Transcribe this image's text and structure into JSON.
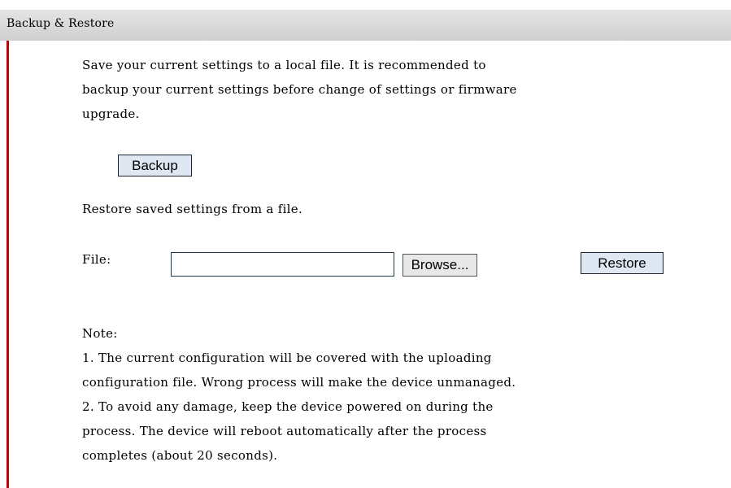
{
  "header": {
    "title": "Backup & Restore"
  },
  "backup": {
    "description_lines": [
      "Save your current settings to a local file. It is recommended to",
      "backup your current settings before change of settings or firmware",
      "upgrade."
    ],
    "button_label": "Backup"
  },
  "restore": {
    "description": "Restore saved settings from a file.",
    "file_label": "File:",
    "file_value": "",
    "browse_label": "Browse...",
    "button_label": "Restore"
  },
  "note": {
    "heading": "Note:",
    "lines": [
      "1. The current configuration will be covered with the uploading",
      "configuration file. Wrong process will make the device unmanaged.",
      "2. To avoid any damage, keep the device powered on during the",
      "process. The device will reboot automatically after the process",
      "completes (about 20 seconds)."
    ]
  },
  "colors": {
    "accent_rule": "#c00000",
    "header_bg": "#d8d8d8",
    "button_bg": "#dfe8f2"
  }
}
